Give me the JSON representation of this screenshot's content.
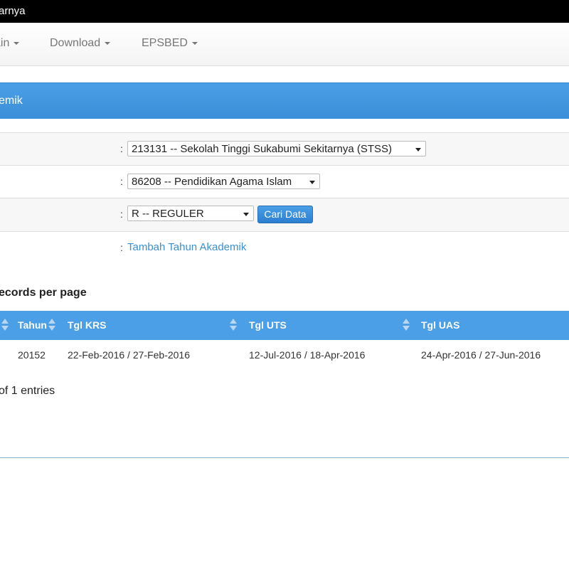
{
  "window": {
    "title": "arnya"
  },
  "navbar": {
    "items": [
      {
        "label": "ain"
      },
      {
        "label": "Download"
      },
      {
        "label": "EPSBED"
      }
    ]
  },
  "panel": {
    "heading": "emik"
  },
  "filters": {
    "colon": ":",
    "perguruan_tinggi": "213131 -- Sekolah Tinggi Sukabumi Sekitarnya (STSS)",
    "program_studi": "86208 -- Pendidikan Agama Islam",
    "kelas": "R -- REGULER",
    "search_button": "Cari Data",
    "add_link": "Tambah Tahun Akademik"
  },
  "datatable": {
    "length_text": "ecords per page",
    "columns": [
      "Tahun",
      "Tgl KRS",
      "Tgl UTS",
      "Tgl UAS"
    ],
    "rows": [
      [
        "20152",
        "22-Feb-2016 / 27-Feb-2016",
        "12-Jul-2016 / 18-Apr-2016",
        "24-Apr-2016 / 27-Jun-2016"
      ]
    ],
    "info_text": "of 1 entries"
  },
  "colors": {
    "primary": "#4a9fe6",
    "link": "#3a8fd8",
    "titlebar": "#000000"
  }
}
